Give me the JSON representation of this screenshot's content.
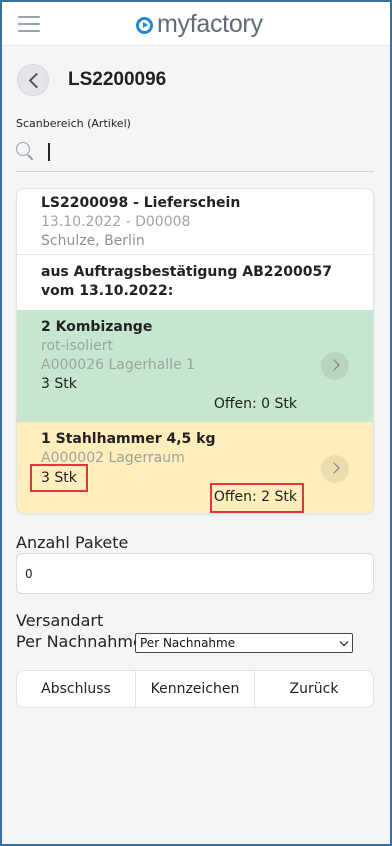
{
  "header": {
    "logo_text": "myfactory",
    "brand_color": "#1e88d6"
  },
  "page": {
    "title": "LS2200096"
  },
  "scan": {
    "label": "Scanbereich (Artikel)",
    "value": ""
  },
  "document": {
    "title": "LS2200098 - Lieferschein",
    "date_line": "13.10.2022 - D00008",
    "customer": "Schulze, Berlin",
    "source": "aus Auftragsbestätigung AB2200057 vom 13.10.2022:"
  },
  "positions": [
    {
      "title": "2 Kombizange",
      "variant": "rot-isoliert",
      "location": "A000026 Lagerhalle 1",
      "qty": "3 Stk",
      "open": "Offen: 0 Stk",
      "color": "#c7e6cf"
    },
    {
      "title": "1 Stahlhammer 4,5 kg",
      "location": "A000002 Lagerraum",
      "qty": "3 Stk",
      "open": "Offen: 2 Stk",
      "color": "#fdeebc"
    }
  ],
  "form": {
    "pakete_label": "Anzahl Pakete",
    "pakete_value": "0",
    "versandart_label": "Versandart",
    "nachnahme_label": "Per Nachnahme",
    "versandart_selected": "Per Nachnahme"
  },
  "buttons": {
    "finish": "Abschluss",
    "mark": "Kennzeichen",
    "back": "Zurück"
  },
  "highlight_color": "#e0373e"
}
